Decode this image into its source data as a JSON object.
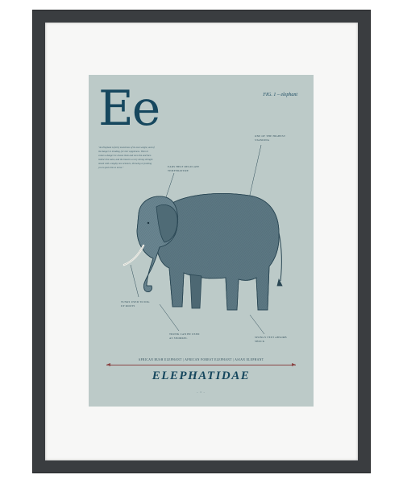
{
  "print": {
    "big_letter": "Ee",
    "fig_label": "FIG. 1 – elephant",
    "quote": "\"An Elephant is fairly monstrous of its own weight, and of the danger in treading, for heir suppleness. When it comes a danger he chases them and sees him and then instinct the same, and the beast is a very strong strength mixed with a mighty one armours, throwing or pushing you to push him to move.\"",
    "notes": {
      "ear": "EARS HELP REGULATE TEMPERATURE",
      "back": "ONE OF THE HIGHEST STANDING",
      "tusks": "TUSKS USED TO DIG UP ROOTS",
      "trunk": "TRUNK CAN BE USED AS SNORKEL",
      "feet": "SPONGY FEET ABSORB SHOCK"
    },
    "species_line": "AFRICAN BUSH ELEPHANT  |  AFRICAN FOREST ELEPHANT  |  ASIAN ELEPHANT",
    "title": "ELEPHATIDAE",
    "page_mark": "– 1 –"
  },
  "colors": {
    "frame": "#3a3d40",
    "mat": "#f7f7f6",
    "print_background": "#bccac8",
    "ink": "#16475e",
    "rule_accent": "#8a4444"
  }
}
